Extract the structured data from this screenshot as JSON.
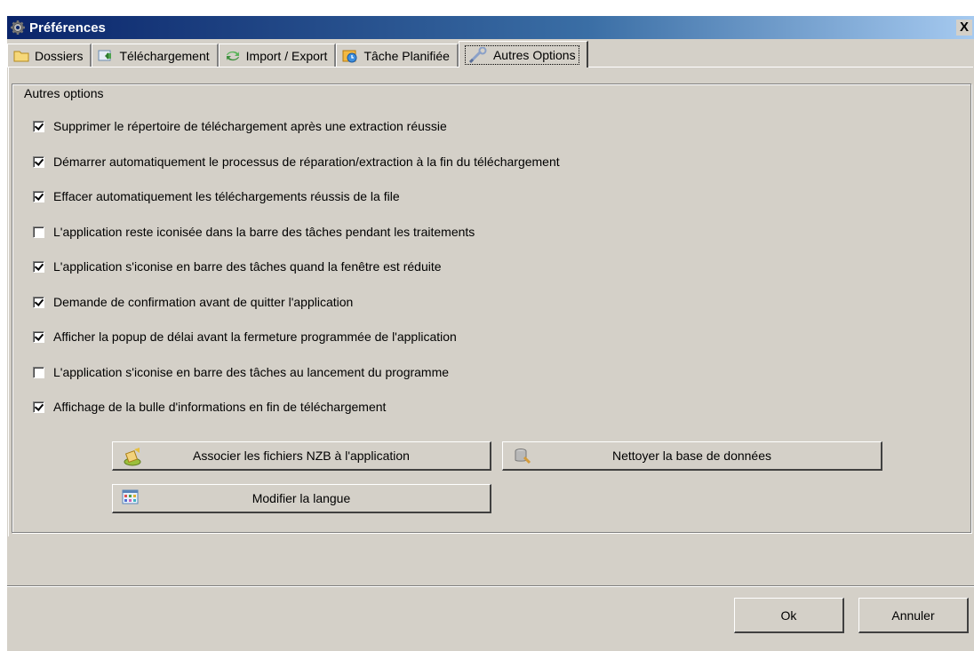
{
  "window": {
    "title": "Préférences",
    "close_glyph": "X"
  },
  "tabs": [
    {
      "label": "Dossiers",
      "icon": "folder-icon"
    },
    {
      "label": "Téléchargement",
      "icon": "download-icon"
    },
    {
      "label": "Import / Export",
      "icon": "sync-arrows-icon"
    },
    {
      "label": "Tâche Planifiée",
      "icon": "scheduled-task-icon"
    },
    {
      "label": "Autres Options",
      "icon": "tools-icon",
      "active": true
    }
  ],
  "group": {
    "legend": "Autres options",
    "options": [
      {
        "label": "Supprimer le répertoire de téléchargement après une extraction réussie",
        "checked": true
      },
      {
        "label": "Démarrer automatiquement le processus de réparation/extraction à la fin du téléchargement",
        "checked": true
      },
      {
        "label": "Effacer automatiquement les téléchargements réussis de la file",
        "checked": true
      },
      {
        "label": "L'application reste iconisée dans la barre des tâches pendant les traitements",
        "checked": false
      },
      {
        "label": "L'application s'iconise en barre des tâches quand la fenêtre est réduite",
        "checked": true
      },
      {
        "label": "Demande de confirmation avant de quitter l'application",
        "checked": true
      },
      {
        "label": "Afficher la popup de délai avant la fermeture programmée de l'application",
        "checked": true
      },
      {
        "label": "L'application s'iconise en barre des tâches au lancement du programme",
        "checked": false
      },
      {
        "label": "Affichage de la bulle d'informations en fin de téléchargement",
        "checked": true
      }
    ],
    "buttons": {
      "associate": "Associer les fichiers NZB à l'application",
      "clean_db": "Nettoyer la base de données",
      "language": "Modifier la langue"
    }
  },
  "footer": {
    "ok": "Ok",
    "cancel": "Annuler"
  }
}
